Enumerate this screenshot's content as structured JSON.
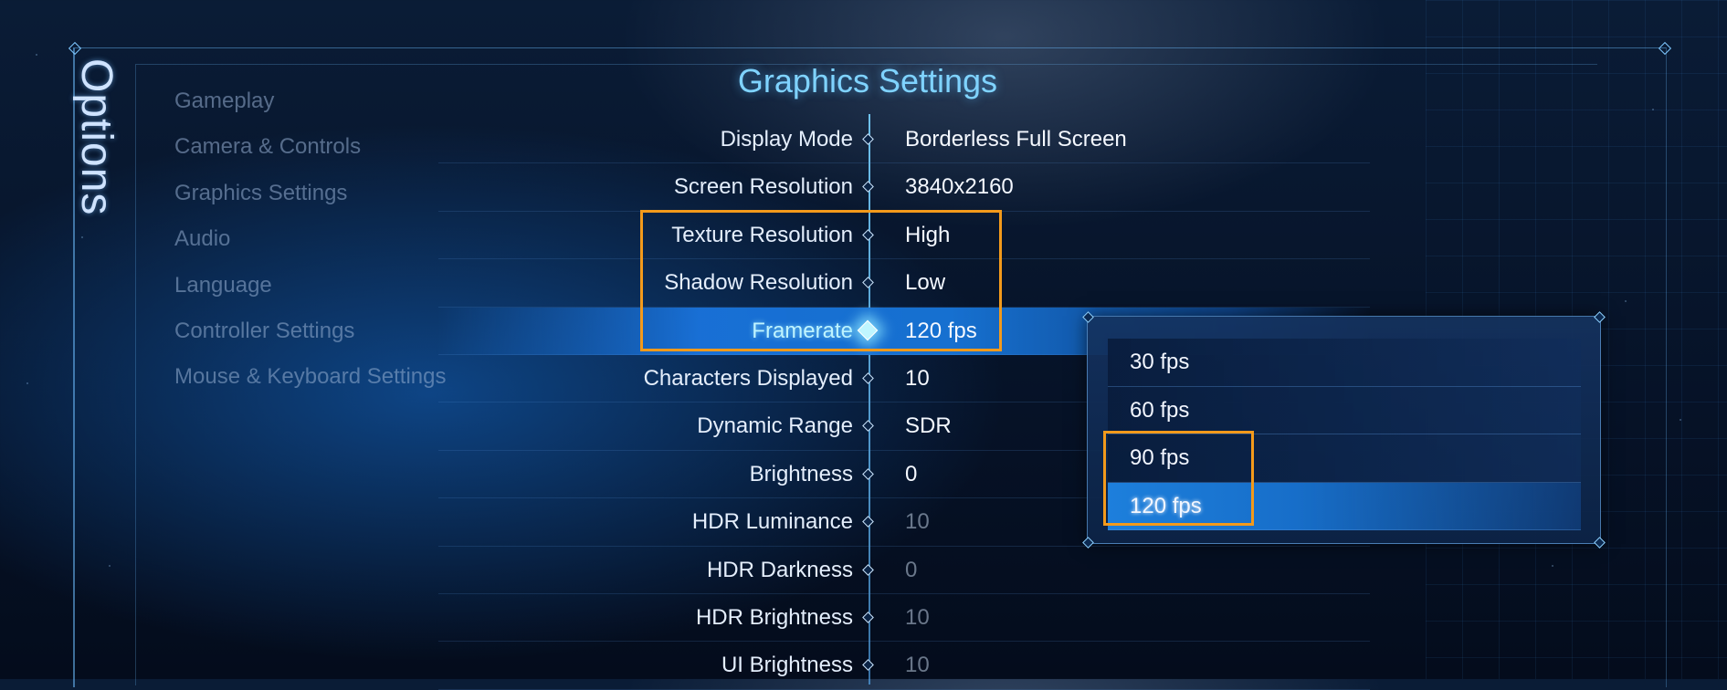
{
  "menu_title": "Options",
  "page_title": "Graphics Settings",
  "nav": [
    {
      "label": "Gameplay"
    },
    {
      "label": "Camera & Controls"
    },
    {
      "label": "Graphics Settings"
    },
    {
      "label": "Audio"
    },
    {
      "label": "Language"
    },
    {
      "label": "Controller Settings"
    },
    {
      "label": "Mouse & Keyboard Settings"
    }
  ],
  "settings": [
    {
      "label": "Display Mode",
      "value": "Borderless Full Screen"
    },
    {
      "label": "Screen Resolution",
      "value": "3840x2160"
    },
    {
      "label": "Texture Resolution",
      "value": "High"
    },
    {
      "label": "Shadow Resolution",
      "value": "Low"
    },
    {
      "label": "Framerate",
      "value": "120 fps",
      "selected": true
    },
    {
      "label": "Characters Displayed",
      "value": "10"
    },
    {
      "label": "Dynamic Range",
      "value": "SDR"
    },
    {
      "label": "Brightness",
      "value": "0"
    },
    {
      "label": "HDR Luminance",
      "value": "10",
      "disabled": true
    },
    {
      "label": "HDR Darkness",
      "value": "0",
      "disabled": true
    },
    {
      "label": "HDR Brightness",
      "value": "10",
      "disabled": true
    },
    {
      "label": "UI Brightness",
      "value": "10",
      "disabled": true
    }
  ],
  "framerate_dropdown": {
    "options": [
      "30 fps",
      "60 fps",
      "90 fps",
      "120 fps"
    ],
    "selected": "120 fps"
  },
  "colors": {
    "accent": "#1670d0",
    "title": "#7fd3ff",
    "highlight_box": "#f39a1b"
  }
}
